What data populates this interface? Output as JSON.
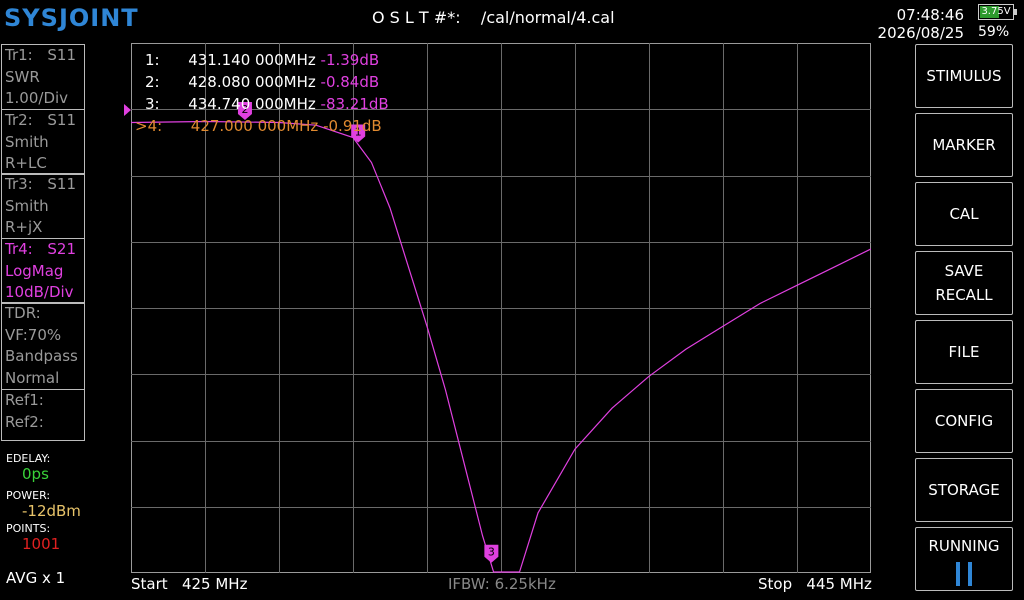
{
  "header": {
    "logo": "SYSJOINT",
    "title": "O S L T #*:    /cal/normal/4.cal",
    "time": "07:48:46",
    "date": "2026/08/25",
    "battery_voltage": "3.75V",
    "battery_percent": "59%",
    "battery_level": 0.59
  },
  "traces": [
    {
      "name": "Tr1:",
      "param": "S11",
      "format": "SWR",
      "scale": "1.00/Div",
      "color": "#9a9a9a"
    },
    {
      "name": "Tr2:",
      "param": "S11",
      "format": "Smith",
      "scale": "R+LC",
      "color": "#9a9a9a"
    },
    {
      "name": "Tr3:",
      "param": "S11",
      "format": "Smith",
      "scale": "R+jX",
      "color": "#9a9a9a"
    },
    {
      "name": "Tr4:",
      "param": "S21",
      "format": "LogMag",
      "scale": "10dB/Div",
      "color": "#e040e0"
    }
  ],
  "tdr": {
    "title": "TDR:",
    "vf": "VF:70%",
    "mode": "Bandpass",
    "window": "Normal"
  },
  "refs": {
    "ref1": "Ref1:",
    "ref2": "Ref2:"
  },
  "settings": {
    "edelay_label": "EDELAY:",
    "edelay_value": "0ps",
    "power_label": "POWER:",
    "power_value": "-12dBm",
    "points_label": "POINTS:",
    "points_value": "1001",
    "avg": "AVG x 1"
  },
  "markers": [
    {
      "label": "1:",
      "freq": "431.140 000MHz",
      "value": "-1.39dB",
      "num": "1"
    },
    {
      "label": "2:",
      "freq": "428.080 000MHz",
      "value": "-0.84dB",
      "num": "2"
    },
    {
      "label": "3:",
      "freq": "434.740 000MHz",
      "value": "-83.21dB",
      "num": "3"
    },
    {
      "label": ">4:",
      "freq": "427.000 000MHz",
      "value": "-0.91dB",
      "num": "4"
    }
  ],
  "bottom": {
    "start": "Start   425 MHz",
    "ifbw": "IFBW: 6.25kHz",
    "stop": "Stop   445 MHz"
  },
  "menu": [
    {
      "label": "STIMULUS"
    },
    {
      "label": "MARKER"
    },
    {
      "label": "CAL"
    },
    {
      "label": "SAVE\nRECALL"
    },
    {
      "label": "FILE"
    },
    {
      "label": "CONFIG"
    },
    {
      "label": "STORAGE"
    },
    {
      "label": "RUNNING"
    }
  ],
  "colors": {
    "trace": "#e040e0",
    "marker_active": "#e08a30",
    "grid": "#6a6a6a",
    "edelay": "#39d239",
    "power": "#e8c46a",
    "points": "#e02020",
    "logo": "#2f86d6"
  },
  "chart_data": {
    "type": "line",
    "x_range_mhz": [
      425,
      445
    ],
    "series": [
      {
        "x": [
          425.0,
          427.0,
          429.0,
          430.0,
          431.0,
          431.5,
          432.0,
          432.5,
          433.0,
          433.5,
          434.0,
          434.5,
          434.8,
          435.2,
          435.5,
          436.0,
          437.0,
          438.0,
          439.0,
          440.0,
          441.0,
          442.0,
          443.0,
          444.0,
          445.0
        ],
        "y_norm": [
          0.012,
          0.01,
          0.012,
          0.018,
          0.045,
          0.1,
          0.2,
          0.33,
          0.46,
          0.6,
          0.76,
          0.92,
          1.0,
          1.0,
          1.0,
          0.87,
          0.73,
          0.64,
          0.57,
          0.51,
          0.46,
          0.41,
          0.37,
          0.33,
          0.29
        ]
      }
    ]
  }
}
